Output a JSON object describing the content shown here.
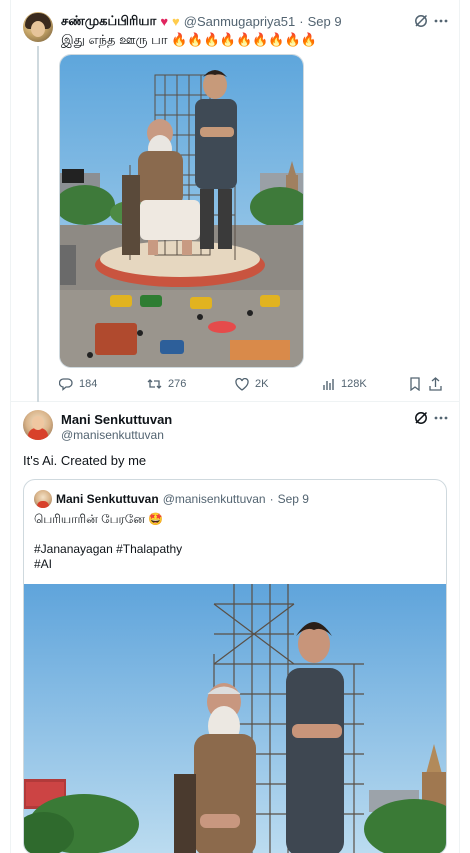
{
  "tweet1": {
    "author_name": "சண்முகப்பிரியா",
    "emoji_hearts": [
      "red-heart",
      "yellow-heart"
    ],
    "handle": "@Sanmugapriya51",
    "separator": "·",
    "date": "Sep 9",
    "text": "இது எந்த ஊரு பா",
    "fire_emoji": "🔥🔥🔥🔥🔥🔥🔥🔥🔥",
    "stats": {
      "replies": "184",
      "reposts": "276",
      "likes": "2K",
      "views": "128K"
    }
  },
  "tweet2": {
    "author_name": "Mani Senkuttuvan",
    "handle": "@manisenkuttuvan",
    "text": "It's Ai. Created by me",
    "quoted": {
      "author_name": "Mani Senkuttuvan",
      "handle": "@manisenkuttuvan",
      "separator": "·",
      "date": "Sep 9",
      "line1": "பெரியாரின் பேரனே 🤩",
      "line2": "",
      "line3": "#Jananayagan #Thalapathy",
      "line4": "#AI"
    }
  },
  "colors": {
    "text_primary": "#0f1419",
    "text_secondary": "#536471",
    "border": "#eff3f4",
    "sky": "#8fc2e8"
  },
  "icons": [
    "grok-icon",
    "more-icon",
    "reply-icon",
    "repost-icon",
    "like-icon",
    "views-icon",
    "bookmark-icon",
    "share-icon"
  ]
}
